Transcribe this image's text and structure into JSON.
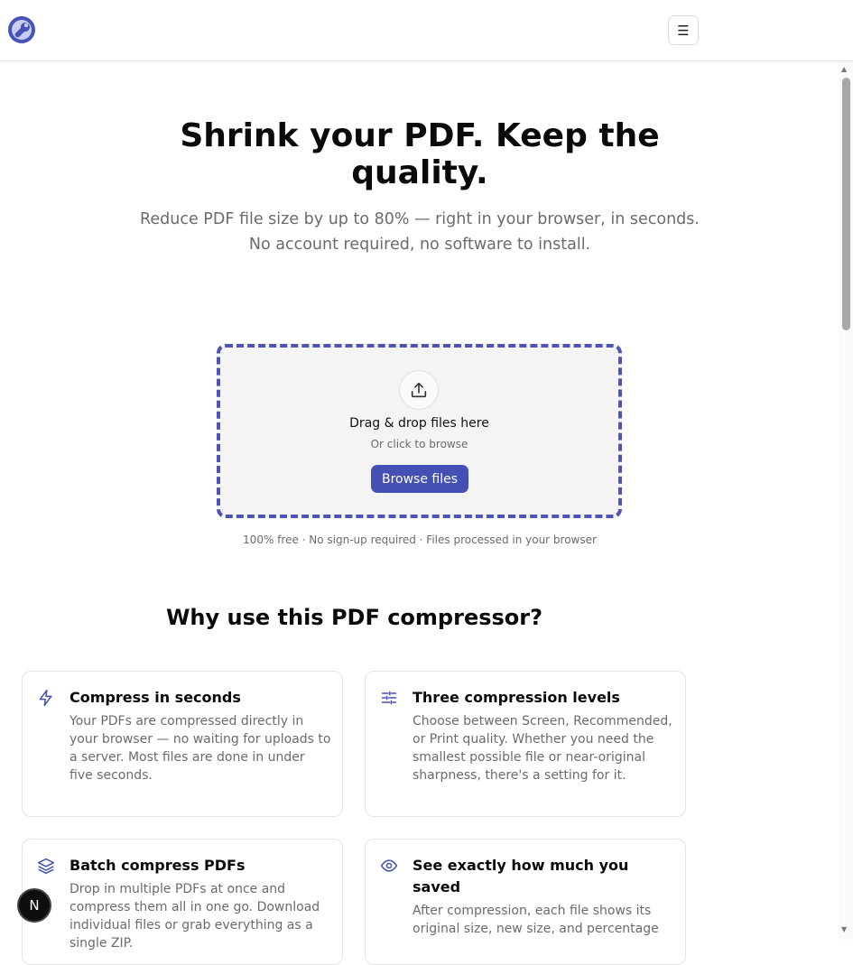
{
  "header": {
    "logo_icon": "wrench-refresh-logo-icon",
    "menu_icon": "hamburger-menu-icon",
    "menu_glyph": "☰"
  },
  "hero": {
    "title": "Shrink your PDF. Keep the quality.",
    "subtitle_line1": "Reduce PDF file size by up to 80% — right in your browser, in seconds.",
    "subtitle_line2": "No account required, no software to install."
  },
  "dropzone": {
    "icon": "upload-icon",
    "title": "Drag & drop files here",
    "subtitle": "Or click to browse",
    "button_label": "Browse files",
    "accent_color": "#4d54b6"
  },
  "free_note": "100% free · No sign-up required · Files processed in your browser",
  "why": {
    "title": "Why use this PDF compressor?",
    "features": [
      {
        "icon": "lightning-icon",
        "title": "Compress in seconds",
        "body": "Your PDFs are compressed directly in your browser — no waiting for uploads to a server. Most files are done in under five seconds."
      },
      {
        "icon": "sliders-icon",
        "title": "Three compression levels",
        "body": "Choose between Screen, Recommended, or Print quality. Whether you need the smallest possible file or near-original sharpness, there's a setting for it."
      },
      {
        "icon": "layers-icon",
        "title": "Batch compress PDFs",
        "body": "Drop in multiple PDFs at once and compress them all in one go. Download individual files or grab everything as a single ZIP."
      },
      {
        "icon": "eye-icon",
        "title": "See exactly how much you saved",
        "body": "After compression, each file shows its original size, new size, and percentage"
      }
    ]
  },
  "dev_badge": {
    "label": "N"
  },
  "colors": {
    "accent": "#4450b4",
    "muted_text": "#6b6b6b"
  }
}
